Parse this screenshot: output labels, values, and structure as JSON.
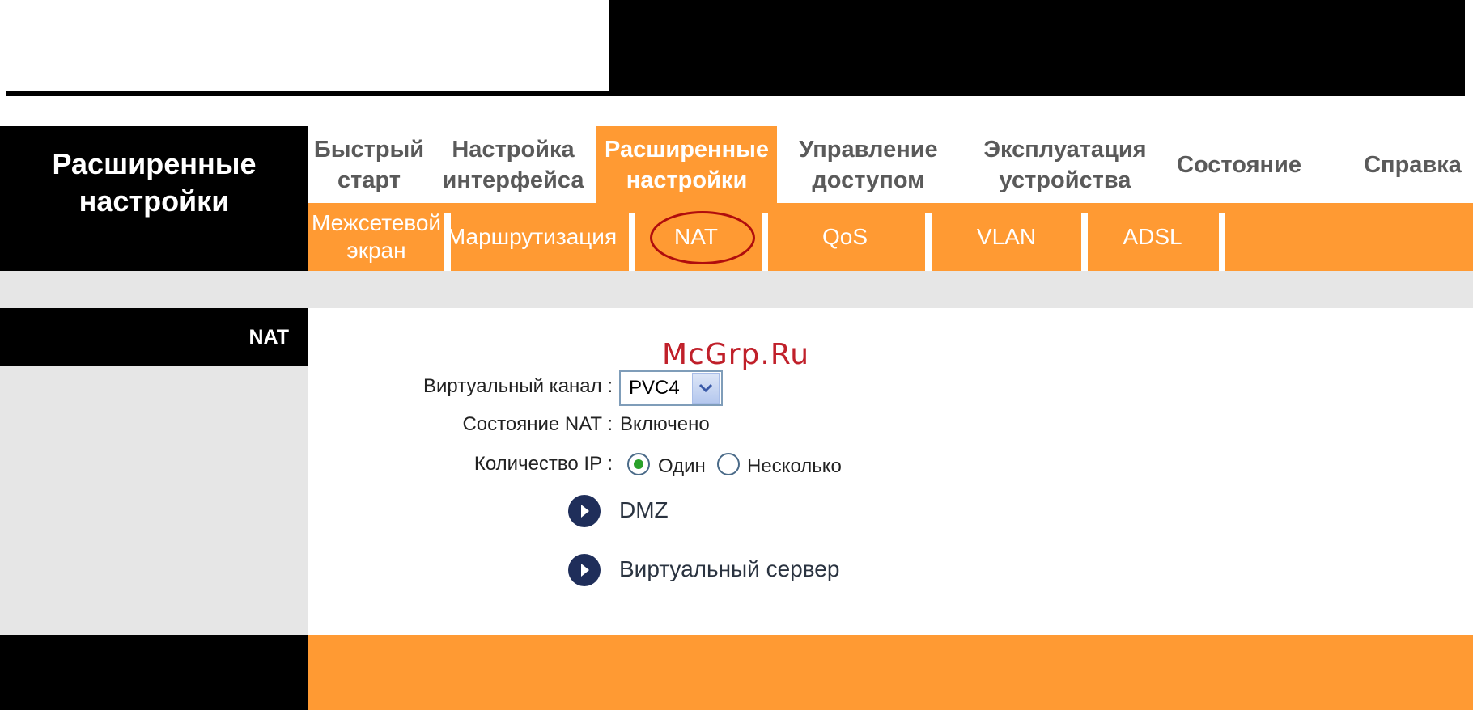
{
  "sidebar": {
    "title_line1": "Расширенные",
    "title_line2": "настройки",
    "section_label": "NAT"
  },
  "main_tabs": [
    {
      "line1": "Быстрый",
      "line2": "старт",
      "active": false
    },
    {
      "line1": "Настройка",
      "line2": "интерфейса",
      "active": false
    },
    {
      "line1": "Расширенные",
      "line2": "настройки",
      "active": true
    },
    {
      "line1": "Управление",
      "line2": "доступом",
      "active": false
    },
    {
      "line1": "Эксплуатация",
      "line2": "устройства",
      "active": false
    },
    {
      "line1": "Состояние",
      "line2": "",
      "active": false
    },
    {
      "line1": "Справка",
      "line2": "",
      "active": false
    }
  ],
  "sub_tabs": [
    {
      "line1": "Межсетевой",
      "line2": "экран"
    },
    {
      "line1": "Маршрутизация",
      "line2": ""
    },
    {
      "line1": "NAT",
      "line2": "",
      "selected": true
    },
    {
      "line1": "QoS",
      "line2": ""
    },
    {
      "line1": "VLAN",
      "line2": ""
    },
    {
      "line1": "ADSL",
      "line2": ""
    }
  ],
  "watermark": "McGrp.Ru",
  "form": {
    "virtual_channel_label": "Виртуальный канал :",
    "virtual_channel_value": "PVC4",
    "nat_state_label": "Состояние NAT :",
    "nat_state_value": "Включено",
    "ip_count_label": "Количество IP :",
    "ip_option_single": "Один",
    "ip_option_multiple": "Несколько",
    "ip_selected": "single"
  },
  "links": {
    "dmz": "DMZ",
    "virtual_server": "Виртуальный сервер"
  },
  "colors": {
    "orange": "#ff9a33",
    "black": "#000000",
    "grey": "#e6e6e6",
    "highlight_ellipse": "#b00d0d",
    "watermark": "#c0202a"
  }
}
